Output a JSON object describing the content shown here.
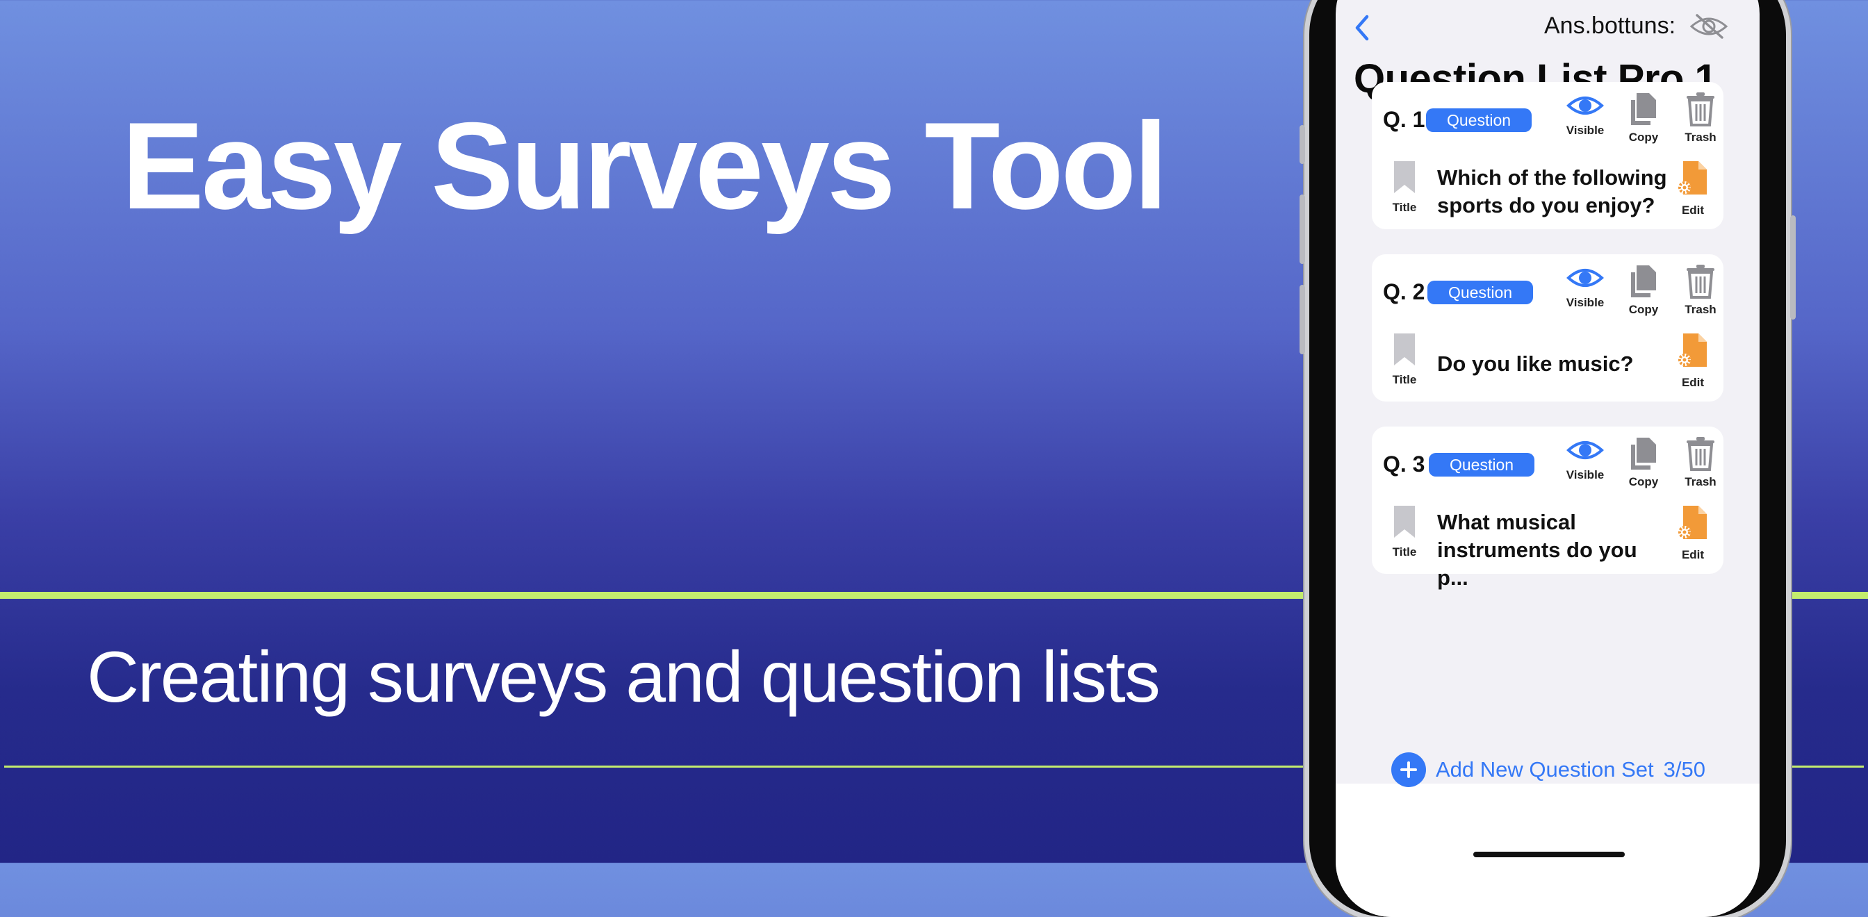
{
  "hero": {
    "title": "Easy Surveys Tool",
    "subtitle": "Creating surveys and question lists"
  },
  "colors": {
    "accent": "#3478f6",
    "highlight_line": "#c4ec6e",
    "edit_icon": "#f29a38",
    "inactive_icon": "#8e8e93"
  },
  "app": {
    "answer_buttons_label": "Ans.bottuns:",
    "answer_buttons_icon": "eye-slash-icon",
    "list_title": "Question List Pro.1",
    "actions": {
      "visible": "Visible",
      "copy": "Copy",
      "trash": "Trash",
      "title": "Title",
      "edit": "Edit"
    },
    "questions": [
      {
        "number": "Q. 1",
        "badge": "Question",
        "text": "Which of the following sports do you enjoy?"
      },
      {
        "number": "Q. 2",
        "badge": "Question",
        "text": "Do you like music?"
      },
      {
        "number": "Q. 3",
        "badge": "Question",
        "text": "What musical instruments do you p..."
      }
    ],
    "add_button": {
      "label": "Add New Question Set",
      "count": "3/50"
    }
  }
}
